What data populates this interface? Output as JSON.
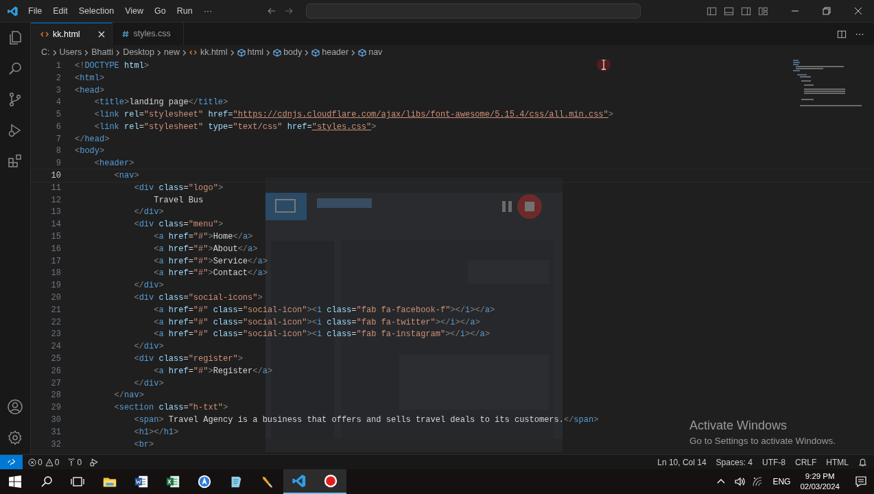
{
  "menu": [
    "File",
    "Edit",
    "Selection",
    "View",
    "Go",
    "Run",
    "···"
  ],
  "tabs": [
    {
      "label": "kk.html",
      "kind": "html",
      "selected": true
    },
    {
      "label": "styles.css",
      "kind": "css",
      "selected": false
    }
  ],
  "breadcrumbs": [
    {
      "label": "C:",
      "kind": "folder"
    },
    {
      "label": "Users",
      "kind": "folder"
    },
    {
      "label": "Bhatti",
      "kind": "folder"
    },
    {
      "label": "Desktop",
      "kind": "folder"
    },
    {
      "label": "new",
      "kind": "folder"
    },
    {
      "label": "kk.html",
      "kind": "html"
    },
    {
      "label": "html",
      "kind": "element"
    },
    {
      "label": "body",
      "kind": "element"
    },
    {
      "label": "header",
      "kind": "element"
    },
    {
      "label": "nav",
      "kind": "element"
    }
  ],
  "editor": {
    "lines": [
      {
        "number": "1",
        "text": "<!DOCTYPE html>",
        "current": false
      },
      {
        "number": "2",
        "text": "<html>",
        "current": false
      },
      {
        "number": "3",
        "text": "<head>",
        "current": false
      },
      {
        "number": "4",
        "text": "    <title>landing page</title>",
        "current": false
      },
      {
        "number": "5",
        "text": "    <link rel=\"stylesheet\" href=\"https://cdnjs.cloudflare.com/ajax/libs/font-awesome/5.15.4/css/all.min.css\">",
        "current": false
      },
      {
        "number": "6",
        "text": "    <link rel=\"stylesheet\" type=\"text/css\" href=\"styles.css\">",
        "current": false
      },
      {
        "number": "7",
        "text": "</head>",
        "current": false
      },
      {
        "number": "8",
        "text": "<body>",
        "current": false
      },
      {
        "number": "9",
        "text": "    <header>",
        "current": false
      },
      {
        "number": "10",
        "text": "        <nav>",
        "current": true
      },
      {
        "number": "11",
        "text": "            <div class=\"logo\">",
        "current": false
      },
      {
        "number": "12",
        "text": "                Travel Bus",
        "current": false
      },
      {
        "number": "13",
        "text": "            </div>",
        "current": false
      },
      {
        "number": "14",
        "text": "            <div class=\"menu\">",
        "current": false
      },
      {
        "number": "15",
        "text": "                <a href=\"#\">Home</a>",
        "current": false
      },
      {
        "number": "16",
        "text": "                <a href=\"#\">About</a>",
        "current": false
      },
      {
        "number": "17",
        "text": "                <a href=\"#\">Service</a>",
        "current": false
      },
      {
        "number": "18",
        "text": "                <a href=\"#\">Contact</a>",
        "current": false
      },
      {
        "number": "19",
        "text": "            </div>",
        "current": false
      },
      {
        "number": "20",
        "text": "            <div class=\"social-icons\">",
        "current": false
      },
      {
        "number": "21",
        "text": "                <a href=\"#\" class=\"social-icon\"><i class=\"fab fa-facebook-f\"></i></a>",
        "current": false
      },
      {
        "number": "22",
        "text": "                <a href=\"#\" class=\"social-icon\"><i class=\"fab fa-twitter\"></i></a>",
        "current": false
      },
      {
        "number": "23",
        "text": "                <a href=\"#\" class=\"social-icon\"><i class=\"fab fa-instagram\"></i></a>",
        "current": false
      },
      {
        "number": "24",
        "text": "            </div>",
        "current": false
      },
      {
        "number": "25",
        "text": "            <div class=\"register\">",
        "current": false
      },
      {
        "number": "26",
        "text": "                <a href=\"#\">Register</a>",
        "current": false
      },
      {
        "number": "27",
        "text": "            </div>",
        "current": false
      },
      {
        "number": "28",
        "text": "        </nav>",
        "current": false
      },
      {
        "number": "29",
        "text": "        <section class=\"h-txt\">",
        "current": false
      },
      {
        "number": "30",
        "text": "            <span> Travel Agency is a business that offers and sells travel deals to its customers.</span>",
        "current": false
      },
      {
        "number": "31",
        "text": "            <h1></h1>",
        "current": false
      },
      {
        "number": "32",
        "text": "            <br>",
        "current": false
      }
    ]
  },
  "activation": {
    "title": "Activate Windows",
    "message": "Go to Settings to activate Windows."
  },
  "status_bar": {
    "errors": "0",
    "warnings": "0",
    "ports": "0",
    "position": "Ln 10, Col 14",
    "spaces": "Spaces: 4",
    "encoding": "UTF-8",
    "eol": "CRLF",
    "language": "HTML"
  },
  "taskbar": {
    "apps": [
      {
        "kind": "explorer",
        "active": false
      },
      {
        "kind": "word",
        "active": false
      },
      {
        "kind": "excel",
        "active": false
      },
      {
        "kind": "compass",
        "active": false
      },
      {
        "kind": "notepad",
        "active": false
      },
      {
        "kind": "tool",
        "active": false
      },
      {
        "kind": "vscode",
        "active": true
      },
      {
        "kind": "recorder",
        "active": true
      }
    ],
    "language": "ENG",
    "time": "9:29 PM",
    "date": "02/03/2024"
  }
}
